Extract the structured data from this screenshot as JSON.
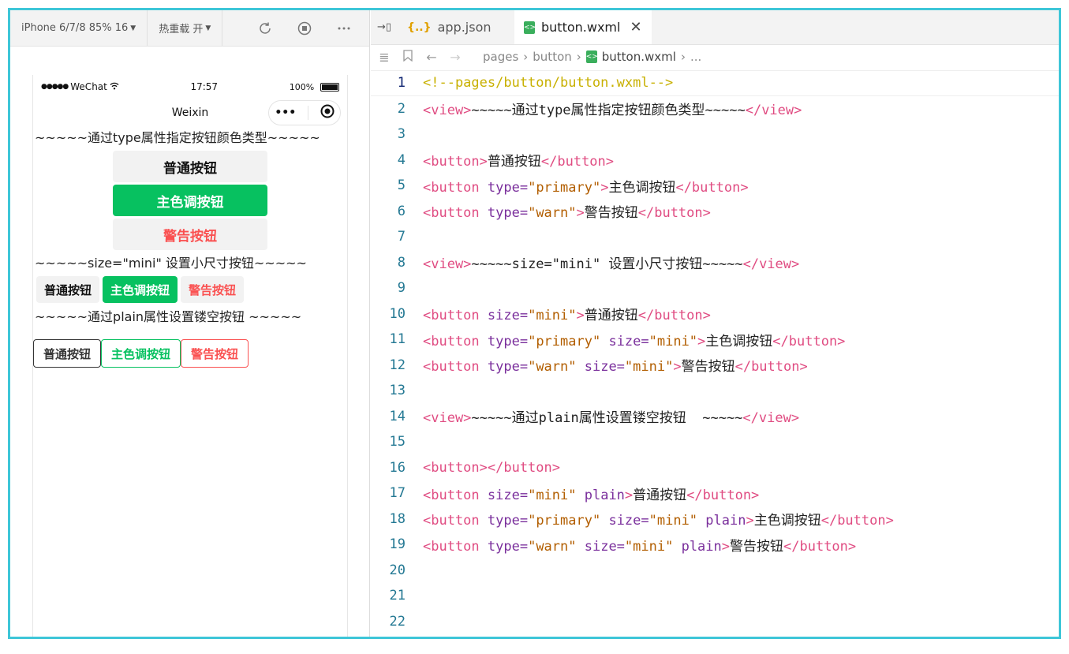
{
  "simulator": {
    "device_label": "iPhone 6/7/8 85% 16",
    "hot_reload_label": "热重载 开",
    "status": {
      "signal": "●●●●●",
      "carrier": "WeChat",
      "time": "17:57",
      "battery": "100%"
    },
    "nav_title": "Weixin",
    "capsule": {
      "more": "•••",
      "close": "⊙"
    },
    "page": {
      "view_type": "~~~~~通过type属性指定按钮颜色类型~~~~~",
      "btn_default": "普通按钮",
      "btn_primary": "主色调按钮",
      "btn_warn": "警告按钮",
      "view_size": "~~~~~size=\"mini\" 设置小尺寸按钮~~~~~",
      "mini_default": "普通按钮",
      "mini_primary": "主色调按钮",
      "mini_warn": "警告按钮",
      "view_plain": "~~~~~通过plain属性设置镂空按钮 ~~~~~",
      "plain_default": "普通按钮",
      "plain_primary": "主色调按钮",
      "plain_warn": "警告按钮"
    }
  },
  "editor": {
    "tabs": [
      {
        "icon": "{..}",
        "label": "app.json"
      },
      {
        "icon": "<>",
        "label": "button.wxml",
        "close": "✕"
      }
    ],
    "breadcrumb": [
      "pages",
      "button",
      "button.wxml",
      "..."
    ],
    "current_line": 1,
    "lines": [
      [
        [
          "comment",
          "<!--pages/button/button.wxml-->"
        ]
      ],
      [
        [
          "tag",
          "<view>"
        ],
        [
          "text",
          "~~~~~通过type属性指定按钮颜色类型~~~~~"
        ],
        [
          "tag",
          "</view>"
        ]
      ],
      [],
      [
        [
          "tag",
          "<button>"
        ],
        [
          "text",
          "普通按钮"
        ],
        [
          "tag",
          "</button>"
        ]
      ],
      [
        [
          "tag",
          "<button "
        ],
        [
          "attr",
          "type="
        ],
        [
          "str",
          "\"primary\""
        ],
        [
          "tag",
          ">"
        ],
        [
          "text",
          "主色调按钮"
        ],
        [
          "tag",
          "</button>"
        ]
      ],
      [
        [
          "tag",
          "<button "
        ],
        [
          "attr",
          "type="
        ],
        [
          "str",
          "\"warn\""
        ],
        [
          "tag",
          ">"
        ],
        [
          "text",
          "警告按钮"
        ],
        [
          "tag",
          "</button>"
        ]
      ],
      [],
      [
        [
          "tag",
          "<view>"
        ],
        [
          "text",
          "~~~~~size=\"mini\" 设置小尺寸按钮~~~~~"
        ],
        [
          "tag",
          "</view>"
        ]
      ],
      [],
      [
        [
          "tag",
          "<button "
        ],
        [
          "attr",
          "size="
        ],
        [
          "str",
          "\"mini\""
        ],
        [
          "tag",
          ">"
        ],
        [
          "text",
          "普通按钮"
        ],
        [
          "tag",
          "</button>"
        ]
      ],
      [
        [
          "tag",
          "<button "
        ],
        [
          "attr",
          "type="
        ],
        [
          "str",
          "\"primary\""
        ],
        [
          "attr",
          " size="
        ],
        [
          "str",
          "\"mini\""
        ],
        [
          "tag",
          ">"
        ],
        [
          "text",
          "主色调按钮"
        ],
        [
          "tag",
          "</button>"
        ]
      ],
      [
        [
          "tag",
          "<button "
        ],
        [
          "attr",
          "type="
        ],
        [
          "str",
          "\"warn\""
        ],
        [
          "attr",
          " size="
        ],
        [
          "str",
          "\"mini\""
        ],
        [
          "tag",
          ">"
        ],
        [
          "text",
          "警告按钮"
        ],
        [
          "tag",
          "</button>"
        ]
      ],
      [],
      [
        [
          "tag",
          "<view>"
        ],
        [
          "text",
          "~~~~~通过plain属性设置镂空按钮  ~~~~~"
        ],
        [
          "tag",
          "</view>"
        ]
      ],
      [],
      [
        [
          "tag",
          "<button></button>"
        ]
      ],
      [
        [
          "tag",
          "<button "
        ],
        [
          "attr",
          "size="
        ],
        [
          "str",
          "\"mini\""
        ],
        [
          "attr",
          " plain"
        ],
        [
          "tag",
          ">"
        ],
        [
          "text",
          "普通按钮"
        ],
        [
          "tag",
          "</button>"
        ]
      ],
      [
        [
          "tag",
          "<button "
        ],
        [
          "attr",
          "type="
        ],
        [
          "str",
          "\"primary\""
        ],
        [
          "attr",
          " size="
        ],
        [
          "str",
          "\"mini\""
        ],
        [
          "attr",
          " plain"
        ],
        [
          "tag",
          ">"
        ],
        [
          "text",
          "主色调按钮"
        ],
        [
          "tag",
          "</button>"
        ]
      ],
      [
        [
          "tag",
          "<button "
        ],
        [
          "attr",
          "type="
        ],
        [
          "str",
          "\"warn\""
        ],
        [
          "attr",
          " size="
        ],
        [
          "str",
          "\"mini\""
        ],
        [
          "attr",
          " plain"
        ],
        [
          "tag",
          ">"
        ],
        [
          "text",
          "警告按钮"
        ],
        [
          "tag",
          "</button>"
        ]
      ],
      [],
      [],
      []
    ]
  }
}
